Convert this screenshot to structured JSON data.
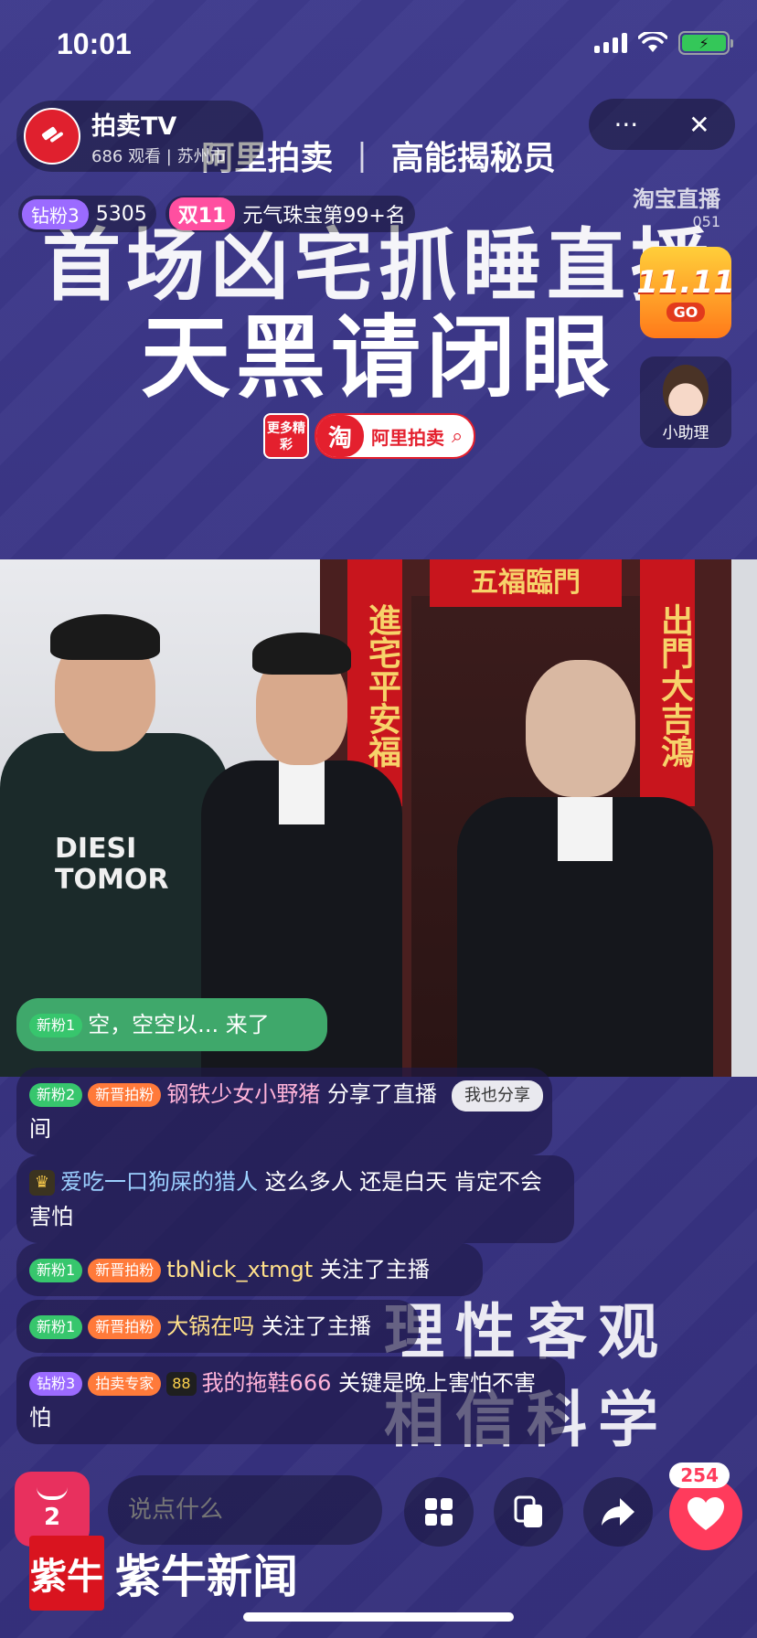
{
  "status_bar": {
    "time": "10:01",
    "battery_icon": "battery-charging-icon"
  },
  "streamer": {
    "name": "拍卖TV",
    "subtitle": "686 观看 | 苏州市"
  },
  "controls": {
    "more": "···",
    "close": "✕"
  },
  "banner": {
    "brand_left": "阿里拍卖",
    "separator": "|",
    "brand_right": "高能揭秘员",
    "headline_1": "首场凶宅抓睡直播",
    "headline_2": "天黑请闭眼",
    "more_label": "更多精彩",
    "tao": "淘",
    "search_label": "阿里拍卖",
    "taobao_live": "淘宝直播",
    "taobao_live_id": "051"
  },
  "badges": {
    "diamond_tag": "钻粉3",
    "diamond_count": "5305",
    "double11_tag": "双11",
    "rank_text": "元气珠宝第99+名"
  },
  "side": {
    "promo_line1": "11.11",
    "promo_line2": "GO",
    "assistant_label": "小助理"
  },
  "video": {
    "couplet_top": "五福臨門",
    "couplet_left": "進宅平安福",
    "couplet_right": "出門大吉鴻",
    "sweater_text": "DIESI TOMOR"
  },
  "chat": {
    "m1": {
      "level": "新粉1",
      "text": "空，空空以... 来了"
    },
    "m2": {
      "level": "新粉2",
      "tag": "新晋拍粉",
      "user": "钢铁少女小野猪",
      "text": " 分享了直播间",
      "share_button": "我也分享"
    },
    "m3": {
      "user": "爱吃一口狗屎的猎人",
      "text": " 这么多人 还是白天 肯定不会害怕"
    },
    "m4": {
      "level": "新粉1",
      "tag": "新晋拍粉",
      "user": "tbNick_xtmgt",
      "text": " 关注了主播"
    },
    "m5": {
      "level": "新粉1",
      "tag": "新晋拍粉",
      "user": "大锅在吗",
      "text": " 关注了主播"
    },
    "m6": {
      "level": "钻粉3",
      "tag": "拍卖专家",
      "num": "88",
      "user": "我的拖鞋666",
      "text": " 关键是晚上害怕不害怕"
    }
  },
  "slogans": {
    "line1": "理性客观",
    "line2": "相信科学"
  },
  "bottom": {
    "cart_count": "2",
    "input_placeholder": "说点什么",
    "like_count": "254"
  },
  "news_logo": {
    "mark": "紫牛",
    "text": "紫牛新闻"
  },
  "colors": {
    "background": "#3a3585",
    "like": "#ff3b5c",
    "cart": "#e8305e",
    "brand_red": "#e4202e"
  }
}
